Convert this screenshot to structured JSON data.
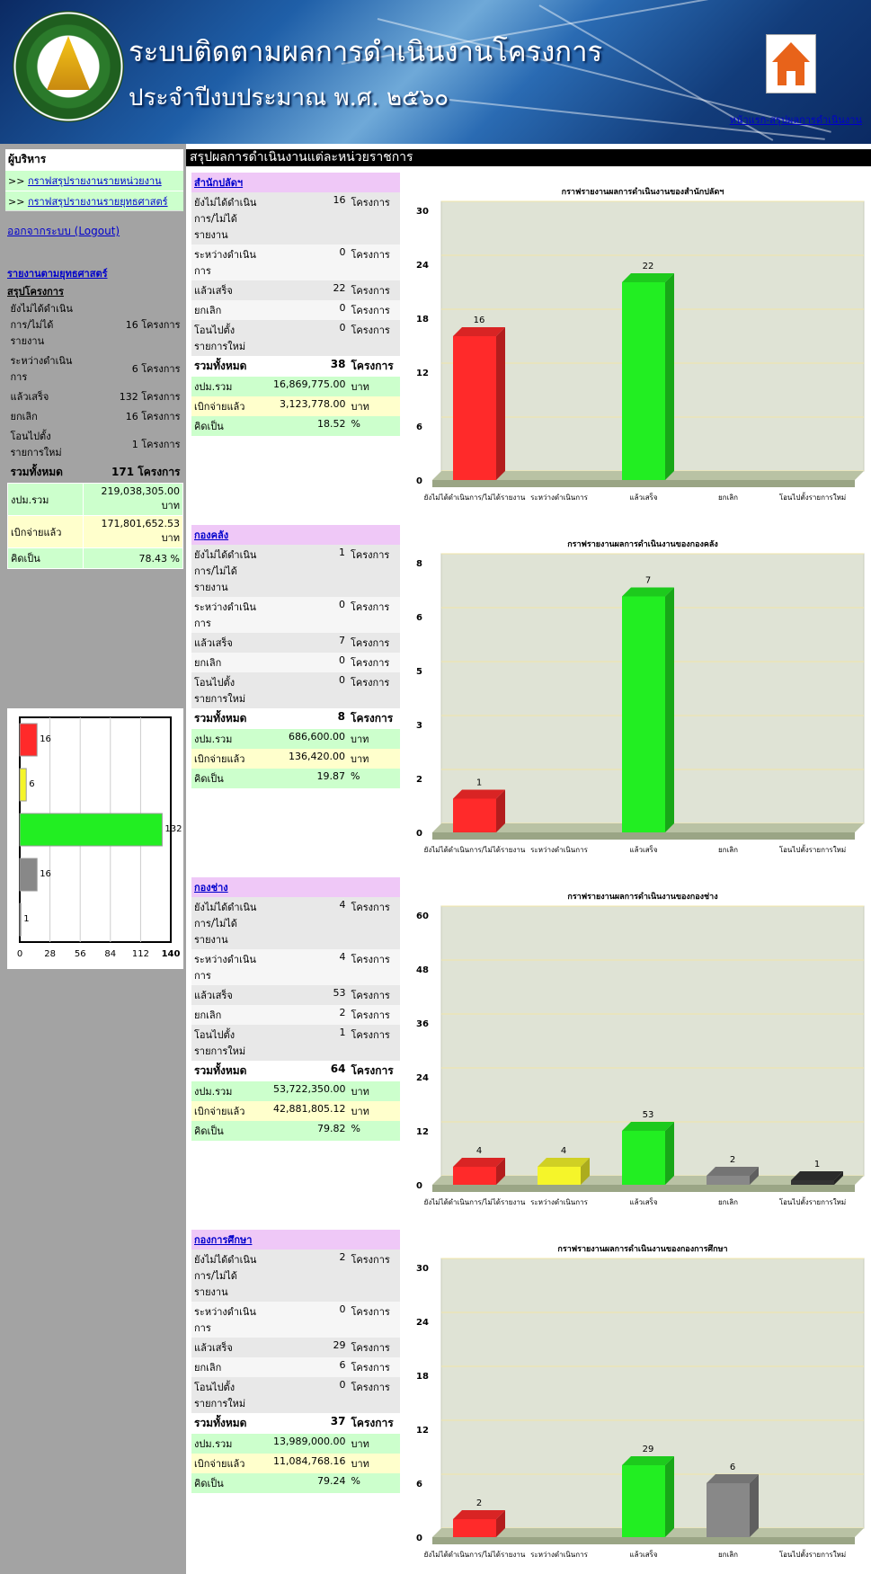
{
  "header": {
    "title": "ระบบติดตามผลการดำเนินงานโครงการ",
    "subtitle": "ประจำปีงบประมาณ พ.ศ. ๒๕๖๐",
    "home_icon": "home-icon",
    "top_link": "หน้าแรก-สรุปผลการดำเนินงาน"
  },
  "sidebar": {
    "menu_title": "ผู้บริหาร",
    "menu_items": [
      {
        "prefix": ">>",
        "label": "กราฟสรุปรายงานรายหน่วยงาน"
      },
      {
        "prefix": ">>",
        "label": "กราฟสรุปรายงานรายยุทธศาสตร์"
      }
    ],
    "logout": "ออกจากระบบ (Logout)",
    "strategy_link": "รายงานตามยุทธศาสตร์",
    "summary_title": "สรุปโครงการ",
    "summary": {
      "rows": [
        {
          "label": "ยังไม่ได้ดำเนินการ/ไม่ได้รายงาน",
          "value": "16 โครงการ"
        },
        {
          "label": "ระหว่างดำเนินการ",
          "value": "6 โครงการ"
        },
        {
          "label": "แล้วเสร็จ",
          "value": "132 โครงการ"
        },
        {
          "label": "ยกเลิก",
          "value": "16 โครงการ"
        },
        {
          "label": "โอนไปตั้งรายการใหม่",
          "value": "1 โครงการ"
        }
      ],
      "total_label": "รวมทั้งหมด",
      "total_value": "171 โครงการ",
      "budget_label": "งปม.รวม",
      "budget_value": "219,038,305.00 บาท",
      "spent_label": "เบิกจ่ายแล้ว",
      "spent_value": "171,801,652.53 บาท",
      "pct_label": "คิดเป็น",
      "pct_value": "78.43 %"
    }
  },
  "sidebar_chart": {
    "type": "bar",
    "orientation": "horizontal",
    "values": [
      16,
      6,
      132,
      16,
      1
    ],
    "colors": [
      "#ff2a2a",
      "#f5f52a",
      "#22ee22",
      "#888888",
      "#333333"
    ],
    "xticks": [
      "0",
      "28",
      "56",
      "84",
      "112",
      "140"
    ],
    "xlim": [
      0,
      140
    ]
  },
  "main": {
    "title": "สรุปผลการดำเนินงานแต่ละหน่วยราชการ",
    "unit_label": "โครงการ",
    "row_labels": [
      "ยังไม่ได้ดำเนินการ/ไม่ได้รายงาน",
      "ระหว่างดำเนินการ",
      "แล้วเสร็จ",
      "ยกเลิก",
      "โอนไปตั้งรายการใหม่"
    ],
    "total_label": "รวมทั้งหมด",
    "budget_label": "งปม.รวม",
    "spent_label": "เบิกจ่ายแล้ว",
    "pct_label": "คิดเป็น",
    "baht": "บาท",
    "percent": "%"
  },
  "chart_data": [
    {
      "type": "bar",
      "agency": "สำนักปลัดฯ",
      "title": "กราฟรายงานผลการดำเนินงานของสำนักปลัดฯ",
      "categories": [
        "ยังไม่ได้ดำเนินการ/ไม่ได้รายงาน",
        "ระหว่างดำเนินการ",
        "แล้วเสร็จ",
        "ยกเลิก",
        "โอนไปตั้งรายการใหม่"
      ],
      "values": [
        16,
        0,
        22,
        0,
        0
      ],
      "yticks": [
        "0",
        "6",
        "12",
        "18",
        "24",
        "30"
      ],
      "ylim": [
        0,
        30
      ],
      "total": "38",
      "budget": "16,869,775.00",
      "spent": "3,123,778.00",
      "pct": "18.52"
    },
    {
      "type": "bar",
      "agency": "กองคลัง",
      "title": "กราฟรายงานผลการดำเนินงานของกองคลัง",
      "categories": [
        "ยังไม่ได้ดำเนินการ/ไม่ได้รายงาน",
        "ระหว่างดำเนินการ",
        "แล้วเสร็จ",
        "ยกเลิก",
        "โอนไปตั้งรายการใหม่"
      ],
      "values": [
        1,
        0,
        7,
        0,
        0
      ],
      "yticks": [
        "0",
        "2",
        "3",
        "5",
        "6",
        "8"
      ],
      "ylim": [
        0,
        8
      ],
      "total": "8",
      "budget": "686,600.00",
      "spent": "136,420.00",
      "pct": "19.87"
    },
    {
      "type": "bar",
      "agency": "กองช่าง",
      "title": "กราฟรายงานผลการดำเนินงานของกองช่าง",
      "categories": [
        "ยังไม่ได้ดำเนินการ/ไม่ได้รายงาน",
        "ระหว่างดำเนินการ",
        "แล้วเสร็จ",
        "ยกเลิก",
        "โอนไปตั้งรายการใหม่"
      ],
      "values": [
        4,
        4,
        53,
        2,
        1
      ],
      "display_values": [
        4,
        4,
        12,
        2,
        1
      ],
      "yticks": [
        "0",
        "12",
        "24",
        "36",
        "48",
        "60"
      ],
      "ylim": [
        0,
        60
      ],
      "total": "64",
      "budget": "53,722,350.00",
      "spent": "42,881,805.12",
      "pct": "79.82"
    },
    {
      "type": "bar",
      "agency": "กองการศึกษา",
      "title": "กราฟรายงานผลการดำเนินงานของกองการศึกษา",
      "categories": [
        "ยังไม่ได้ดำเนินการ/ไม่ได้รายงาน",
        "ระหว่างดำเนินการ",
        "แล้วเสร็จ",
        "ยกเลิก",
        "โอนไปตั้งรายการใหม่"
      ],
      "values": [
        2,
        0,
        29,
        6,
        0
      ],
      "display_values": [
        2,
        0,
        8,
        6,
        0
      ],
      "yticks": [
        "0",
        "6",
        "12",
        "18",
        "24",
        "30"
      ],
      "ylim": [
        0,
        30
      ],
      "total": "37",
      "budget": "13,989,000.00",
      "spent": "11,084,768.16",
      "pct": "79.24"
    }
  ],
  "colors": {
    "not_started": "#ff2a2a",
    "in_progress": "#f5f52a",
    "done": "#22ee22",
    "cancelled": "#888888",
    "transferred": "#333333",
    "sidebar_bg": "#a3a3a3",
    "title_bar": "#000000",
    "section_header": "#efc8f7"
  }
}
